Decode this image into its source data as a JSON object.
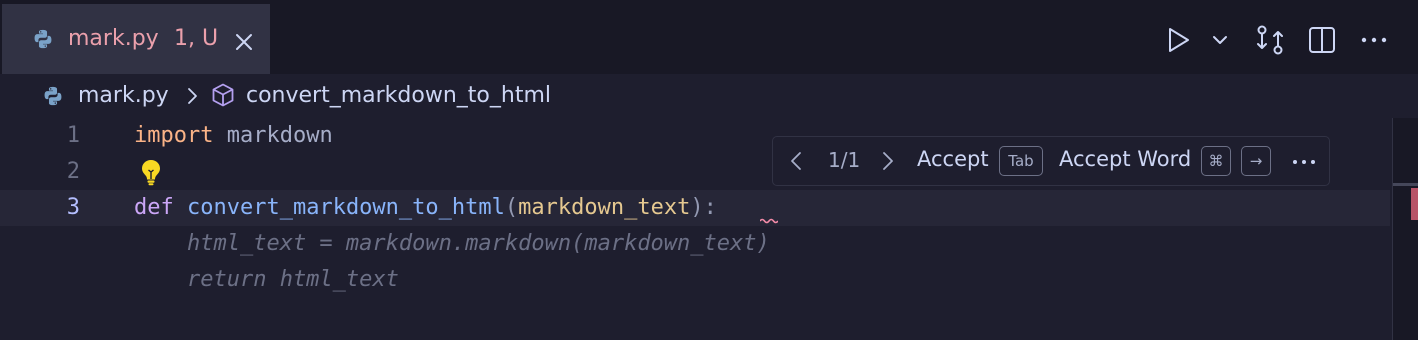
{
  "tab": {
    "file_name": "mark.py",
    "status": "1, U",
    "icon": "python-icon",
    "close_icon": "close-icon"
  },
  "toolbar": {
    "run_icon": "play-icon",
    "run_menu_icon": "chevron-down-icon",
    "compare_icon": "compare-changes-icon",
    "split_icon": "split-editor-icon",
    "more_icon": "more-actions-icon"
  },
  "breadcrumb": {
    "file": "mark.py",
    "symbol": "convert_markdown_to_html"
  },
  "lines": [
    {
      "number": "1",
      "tokens": {
        "kw": "import",
        "rest": "markdown"
      }
    },
    {
      "number": "2"
    },
    {
      "number": "3",
      "tokens": {
        "kw": "def",
        "name": "convert_markdown_to_html",
        "open": "(",
        "param": "markdown_text",
        "close": ")",
        "colon": ":"
      }
    }
  ],
  "ghost_text": [
    "    html_text = markdown.markdown(markdown_text)",
    "    return html_text"
  ],
  "suggestion": {
    "count": "1/1",
    "accept": "Accept",
    "accept_key": "Tab",
    "accept_word": "Accept Word",
    "cmd_key": "⌘",
    "arrow_key": "→"
  },
  "colors": {
    "tab_text_modified": "#eba0ac",
    "keyword_import": "#fab387",
    "keyword_def": "#cba6f7",
    "function_name": "#89b4fa",
    "parameter": "#e5c890",
    "background": "#1e1e2e"
  }
}
